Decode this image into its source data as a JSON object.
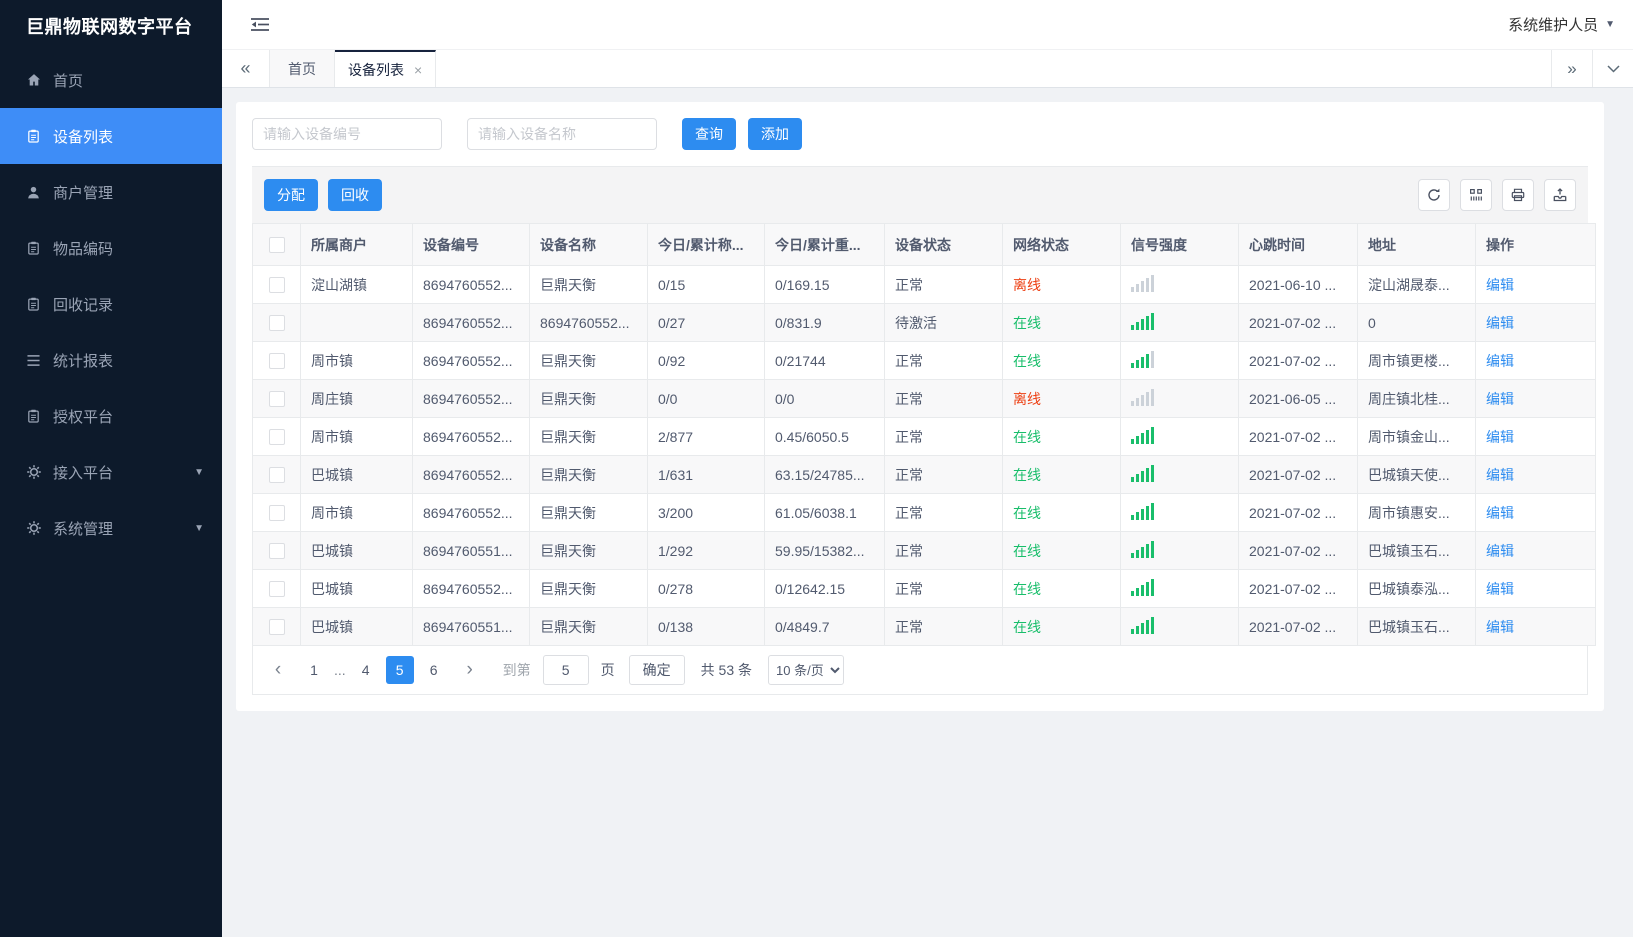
{
  "app": {
    "title": "巨鼎物联网数字平台",
    "user_role": "系统维护人员"
  },
  "colors": {
    "sidebar_bg": "#0d1a2b",
    "sidebar_active": "#3e8df7",
    "accent": "#2d8cf0",
    "success": "#19be6b",
    "danger": "#ed4014",
    "link": "#2d8cf0",
    "content_bg": "#f0f2f5",
    "stripe": "#f8f8f9",
    "border": "#e8eaec"
  },
  "sidebar": {
    "items": [
      {
        "label": "首页",
        "icon": "home-icon",
        "active": false,
        "expandable": false
      },
      {
        "label": "设备列表",
        "icon": "device-list-icon",
        "active": true,
        "expandable": false
      },
      {
        "label": "商户管理",
        "icon": "merchant-icon",
        "active": false,
        "expandable": false
      },
      {
        "label": "物品编码",
        "icon": "item-code-icon",
        "active": false,
        "expandable": false
      },
      {
        "label": "回收记录",
        "icon": "recycle-record-icon",
        "active": false,
        "expandable": false
      },
      {
        "label": "统计报表",
        "icon": "report-icon",
        "active": false,
        "expandable": false
      },
      {
        "label": "授权平台",
        "icon": "authorize-icon",
        "active": false,
        "expandable": false
      },
      {
        "label": "接入平台",
        "icon": "gear-icon",
        "active": false,
        "expandable": true
      },
      {
        "label": "系统管理",
        "icon": "gear-icon",
        "active": false,
        "expandable": true
      }
    ]
  },
  "tabs": {
    "items": [
      {
        "label": "首页",
        "active": false,
        "closable": false
      },
      {
        "label": "设备列表",
        "active": true,
        "closable": true
      }
    ]
  },
  "search": {
    "device_no_placeholder": "请输入设备编号",
    "device_name_placeholder": "请输入设备名称",
    "query_label": "查询",
    "add_label": "添加"
  },
  "toolbar": {
    "assign_label": "分配",
    "recycle_label": "回收",
    "icons": [
      "refresh-icon",
      "columns-icon",
      "print-icon",
      "export-icon"
    ]
  },
  "table": {
    "headers": [
      "所属商户",
      "设备编号",
      "设备名称",
      "今日/累计称...",
      "今日/累计重...",
      "设备状态",
      "网络状态",
      "信号强度",
      "心跳时间",
      "地址",
      "操作"
    ],
    "action_label": "编辑",
    "rows": [
      {
        "merchant": "淀山湖镇",
        "device_no": "8694760552...",
        "device_name": "巨鼎天衡",
        "today_count": "0/15",
        "today_weight": "0/169.15",
        "device_status": "正常",
        "network_status": "离线",
        "online": false,
        "signal_level": 0,
        "heartbeat": "2021-06-10 ...",
        "address": "淀山湖晟泰..."
      },
      {
        "merchant": "",
        "device_no": "8694760552...",
        "device_name": "8694760552...",
        "today_count": "0/27",
        "today_weight": "0/831.9",
        "device_status": "待激活",
        "network_status": "在线",
        "online": true,
        "signal_level": 5,
        "heartbeat": "2021-07-02 ...",
        "address": "0"
      },
      {
        "merchant": "周市镇",
        "device_no": "8694760552...",
        "device_name": "巨鼎天衡",
        "today_count": "0/92",
        "today_weight": "0/21744",
        "device_status": "正常",
        "network_status": "在线",
        "online": true,
        "signal_level": 4,
        "heartbeat": "2021-07-02 ...",
        "address": "周市镇更楼..."
      },
      {
        "merchant": "周庄镇",
        "device_no": "8694760552...",
        "device_name": "巨鼎天衡",
        "today_count": "0/0",
        "today_weight": "0/0",
        "device_status": "正常",
        "network_status": "离线",
        "online": false,
        "signal_level": 0,
        "heartbeat": "2021-06-05 ...",
        "address": "周庄镇北桂..."
      },
      {
        "merchant": "周市镇",
        "device_no": "8694760552...",
        "device_name": "巨鼎天衡",
        "today_count": "2/877",
        "today_weight": "0.45/6050.5",
        "device_status": "正常",
        "network_status": "在线",
        "online": true,
        "signal_level": 5,
        "heartbeat": "2021-07-02 ...",
        "address": "周市镇金山..."
      },
      {
        "merchant": "巴城镇",
        "device_no": "8694760552...",
        "device_name": "巨鼎天衡",
        "today_count": "1/631",
        "today_weight": "63.15/24785...",
        "device_status": "正常",
        "network_status": "在线",
        "online": true,
        "signal_level": 5,
        "heartbeat": "2021-07-02 ...",
        "address": "巴城镇天使..."
      },
      {
        "merchant": "周市镇",
        "device_no": "8694760552...",
        "device_name": "巨鼎天衡",
        "today_count": "3/200",
        "today_weight": "61.05/6038.1",
        "device_status": "正常",
        "network_status": "在线",
        "online": true,
        "signal_level": 5,
        "heartbeat": "2021-07-02 ...",
        "address": "周市镇惠安..."
      },
      {
        "merchant": "巴城镇",
        "device_no": "8694760551...",
        "device_name": "巨鼎天衡",
        "today_count": "1/292",
        "today_weight": "59.95/15382...",
        "device_status": "正常",
        "network_status": "在线",
        "online": true,
        "signal_level": 5,
        "heartbeat": "2021-07-02 ...",
        "address": "巴城镇玉石..."
      },
      {
        "merchant": "巴城镇",
        "device_no": "8694760552...",
        "device_name": "巨鼎天衡",
        "today_count": "0/278",
        "today_weight": "0/12642.15",
        "device_status": "正常",
        "network_status": "在线",
        "online": true,
        "signal_level": 5,
        "heartbeat": "2021-07-02 ...",
        "address": "巴城镇泰泓..."
      },
      {
        "merchant": "巴城镇",
        "device_no": "8694760551...",
        "device_name": "巨鼎天衡",
        "today_count": "0/138",
        "today_weight": "0/4849.7",
        "device_status": "正常",
        "network_status": "在线",
        "online": true,
        "signal_level": 5,
        "heartbeat": "2021-07-02 ...",
        "address": "巴城镇玉石..."
      }
    ]
  },
  "pagination": {
    "pages": [
      "1",
      "...",
      "4",
      "5",
      "6"
    ],
    "active_page": "5",
    "goto_label": "到第",
    "goto_value": "5",
    "page_unit": "页",
    "confirm_label": "确定",
    "total_label": "共 53 条",
    "page_size": "10 条/页"
  }
}
